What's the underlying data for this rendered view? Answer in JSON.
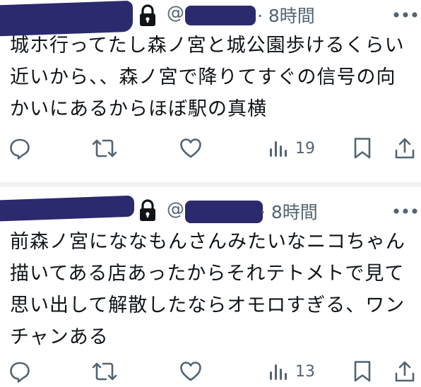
{
  "tweets": [
    {
      "at_symbol": "@",
      "time": "· 8時間",
      "text": "城ホ行ってたし森ノ宮と城公園歩けるくらい\n近いから、、森ノ宮で降りてすぐの信号の向\nかいにあるからほぼ駅の真横",
      "view_count": "19",
      "icons": [
        "lock-icon",
        "more-icon",
        "reply-icon",
        "retweet-icon",
        "heart-icon",
        "views-icon",
        "bookmark-icon",
        "share-icon"
      ]
    },
    {
      "at_symbol": "@",
      "time": "· 8時間",
      "text": "前森ノ宮にななもんさんみたいなニコちゃん\n描いてある店あったからそれテトメトで見て\n思い出して解散したならオモロすぎる、ワン\nチャンある",
      "view_count": "13",
      "icons": [
        "lock-icon",
        "more-icon",
        "reply-icon",
        "retweet-icon",
        "heart-icon",
        "views-icon",
        "bookmark-icon",
        "share-icon"
      ]
    }
  ],
  "colors": {
    "redaction": "#2b2a6e",
    "muted": "#536471",
    "text": "#0f1419",
    "divider": "#eff3f4"
  }
}
